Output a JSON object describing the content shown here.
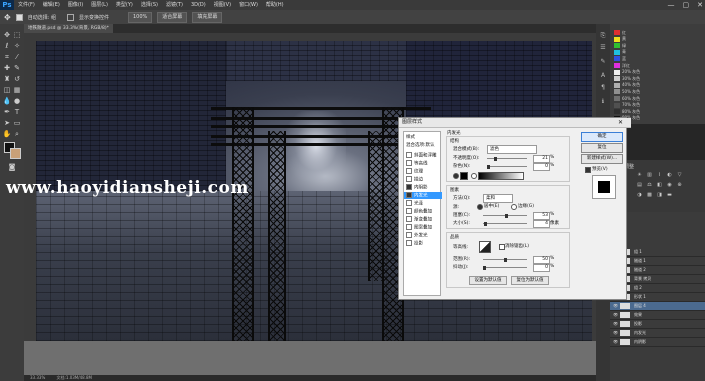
{
  "menu": {
    "logo": "Ps",
    "items": [
      "文件(F)",
      "编辑(E)",
      "图像(I)",
      "图层(L)",
      "类型(Y)",
      "选择(S)",
      "滤镜(T)",
      "3D(D)",
      "视图(V)",
      "窗口(W)",
      "帮助(H)"
    ],
    "window_controls": [
      "—",
      "▢",
      "✕"
    ]
  },
  "options": {
    "auto_select_label": "自动选择: 组",
    "show_transform_label": "显示变换控件",
    "zoom_label": "100%",
    "fit_screen_label": "适合屏幕",
    "fill_screen_label": "填充屏幕"
  },
  "document": {
    "tab_title": "地铁隧道.psd @ 33.3%(背景, RGB/8)*"
  },
  "watermark": "www.haoyidiansheji.com",
  "status": {
    "zoom": "33.33%",
    "doc_size": "文档:1.03M/48.8M"
  },
  "swatches": [
    {
      "color": "#e03030",
      "label": "红"
    },
    {
      "color": "#f0e020",
      "label": "黄"
    },
    {
      "color": "#30c030",
      "label": "绿"
    },
    {
      "color": "#20c0e0",
      "label": "青"
    },
    {
      "color": "#3050e0",
      "label": "蓝"
    },
    {
      "color": "#e030e0",
      "label": "洋红"
    },
    {
      "color": "#f0f0f0",
      "label": "20% 灰色"
    },
    {
      "color": "#d0d0d0",
      "label": "30% 灰色"
    },
    {
      "color": "#b0b0b0",
      "label": "40% 灰色"
    },
    {
      "color": "#909090",
      "label": "50% 灰色"
    },
    {
      "color": "#707070",
      "label": "60% 灰色"
    },
    {
      "color": "#505050",
      "label": "70% 灰色"
    },
    {
      "color": "#303030",
      "label": "80% 灰色"
    },
    {
      "color": "#101010",
      "label": "90% 灰色"
    }
  ],
  "adjustments": {
    "title": "添加调整"
  },
  "layers": {
    "rows": [
      "组 1",
      "隧道 1",
      "隧道 2",
      "背景 拷贝",
      "组 2",
      "形状 1",
      "图层 4",
      "效果",
      "投影",
      "内发光",
      "内阴影"
    ]
  },
  "dialog": {
    "title": "图层样式",
    "close": "✕",
    "styles_header": "样式",
    "blend_options": "混合选项:默认",
    "items": [
      {
        "label": "斜面和浮雕",
        "checked": false
      },
      {
        "label": "等高线",
        "checked": false
      },
      {
        "label": "纹理",
        "checked": false
      },
      {
        "label": "描边",
        "checked": false
      },
      {
        "label": "内阴影",
        "checked": true
      },
      {
        "label": "内发光",
        "checked": true,
        "selected": true
      },
      {
        "label": "光泽",
        "checked": false
      },
      {
        "label": "颜色叠加",
        "checked": false
      },
      {
        "label": "渐变叠加",
        "checked": false
      },
      {
        "label": "图案叠加",
        "checked": false
      },
      {
        "label": "外发光",
        "checked": false
      },
      {
        "label": "投影",
        "checked": false
      }
    ],
    "section_title": "内发光",
    "structure_title": "结构",
    "blend_mode_label": "混合模式(B):",
    "blend_mode_value": "滤色",
    "opacity_label": "不透明度(O):",
    "opacity_value": "21",
    "noise_label": "杂色(N):",
    "noise_value": "0",
    "percent": "%",
    "elements_title": "图素",
    "method_label": "方法(Q):",
    "method_value": "柔和",
    "source_label": "源:",
    "source_center": "居中(E)",
    "source_edge": "边缘(G)",
    "choke_label": "阻塞(C):",
    "choke_value": "53",
    "size_label": "大小(S):",
    "size_value": "4",
    "px": "像素",
    "quality_title": "品质",
    "contour_label": "等高线:",
    "antialias_label": "消除锯齿(L)",
    "range_label": "范围(R):",
    "range_value": "50",
    "jitter_label": "抖动(J):",
    "jitter_value": "0",
    "set_default": "设置为默认值",
    "reset_default": "复位为默认值",
    "ok": "确定",
    "cancel": "复位",
    "new_style": "新建样式(W)...",
    "preview": "预览(V)"
  }
}
